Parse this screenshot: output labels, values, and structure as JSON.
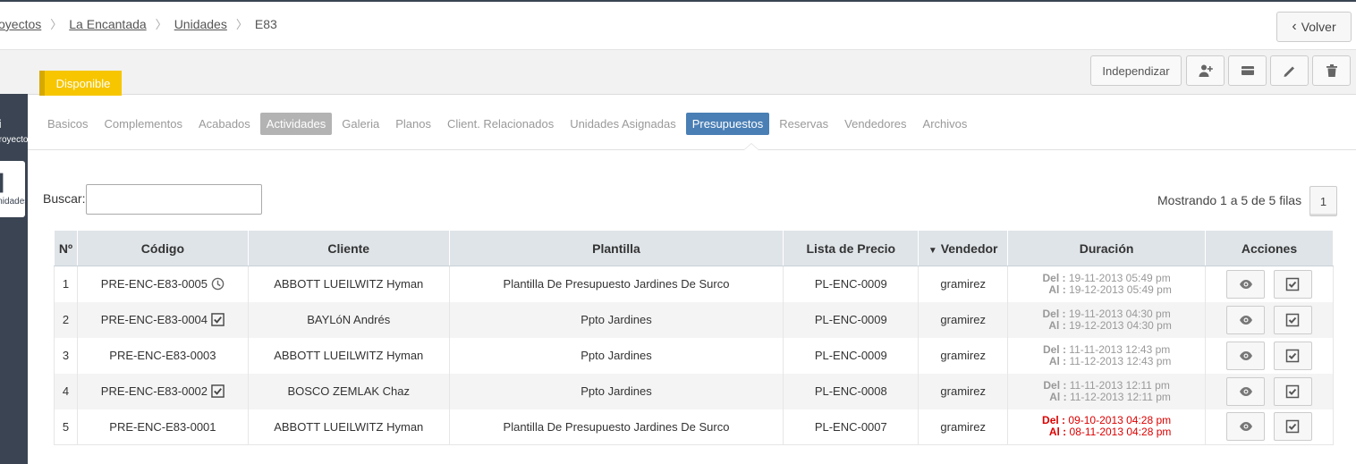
{
  "breadcrumb": {
    "items": [
      "Proyectos",
      "La Encantada",
      "Unidades"
    ],
    "current": "E83"
  },
  "back_button": {
    "label": "Volver"
  },
  "status": {
    "label": "Disponible",
    "color": "#f7c600"
  },
  "toolbar": {
    "independizar_label": "Independizar"
  },
  "sidebar": {
    "items": [
      {
        "glyph": "i",
        "label": "Proyectos"
      },
      {
        "glyph": "▌",
        "label": "Unidades"
      }
    ]
  },
  "tabs": [
    {
      "label": "Basicos",
      "state": "normal"
    },
    {
      "label": "Complementos",
      "state": "normal"
    },
    {
      "label": "Acabados",
      "state": "normal"
    },
    {
      "label": "Actividades",
      "state": "gray"
    },
    {
      "label": "Galeria",
      "state": "normal"
    },
    {
      "label": "Planos",
      "state": "normal"
    },
    {
      "label": "Client. Relacionados",
      "state": "normal"
    },
    {
      "label": "Unidades Asignadas",
      "state": "normal"
    },
    {
      "label": "Presupuestos",
      "state": "active"
    },
    {
      "label": "Reservas",
      "state": "normal"
    },
    {
      "label": "Vendedores",
      "state": "normal"
    },
    {
      "label": "Archivos",
      "state": "normal"
    }
  ],
  "search": {
    "label": "Buscar:",
    "value": ""
  },
  "pagination": {
    "summary": "Mostrando 1 a 5 de 5 filas",
    "page": "1"
  },
  "table": {
    "headers": [
      "Nº",
      "Código",
      "Cliente",
      "Plantilla",
      "Lista de Precio",
      "Vendedor",
      "Duración",
      "Acciones"
    ],
    "sort_indicator": "▼",
    "del_label": "Del :",
    "al_label": "Al :",
    "rows": [
      {
        "n": "1",
        "code": "PRE-ENC-E83-0005",
        "code_icon": "clock-icon",
        "client": "ABBOTT LUEILWITZ Hyman",
        "template": "Plantilla De Presupuesto Jardines De Surco",
        "price_list": "PL-ENC-0009",
        "seller": "gramirez",
        "del": "19-11-2013 05:49 pm",
        "al": "19-12-2013 05:49 pm",
        "expired": false
      },
      {
        "n": "2",
        "code": "PRE-ENC-E83-0004",
        "code_icon": "check-icon",
        "client": "BAYLóN Andrés",
        "template": "Ppto Jardines",
        "price_list": "PL-ENC-0009",
        "seller": "gramirez",
        "del": "19-11-2013 04:30 pm",
        "al": "19-12-2013 04:30 pm",
        "expired": false
      },
      {
        "n": "3",
        "code": "PRE-ENC-E83-0003",
        "code_icon": "",
        "client": "ABBOTT LUEILWITZ Hyman",
        "template": "Ppto Jardines",
        "price_list": "PL-ENC-0009",
        "seller": "gramirez",
        "del": "11-11-2013 12:43 pm",
        "al": "11-12-2013 12:43 pm",
        "expired": false
      },
      {
        "n": "4",
        "code": "PRE-ENC-E83-0002",
        "code_icon": "check-icon",
        "client": "BOSCO ZEMLAK Chaz",
        "template": "Ppto Jardines",
        "price_list": "PL-ENC-0008",
        "seller": "gramirez",
        "del": "11-11-2013 12:11 pm",
        "al": "11-12-2013 12:11 pm",
        "expired": false
      },
      {
        "n": "5",
        "code": "PRE-ENC-E83-0001",
        "code_icon": "",
        "client": "ABBOTT LUEILWITZ Hyman",
        "template": "Plantilla De Presupuesto Jardines De Surco",
        "price_list": "PL-ENC-0007",
        "seller": "gramirez",
        "del": "09-10-2013 04:28 pm",
        "al": "08-11-2013 04:28 pm",
        "expired": true
      }
    ]
  }
}
